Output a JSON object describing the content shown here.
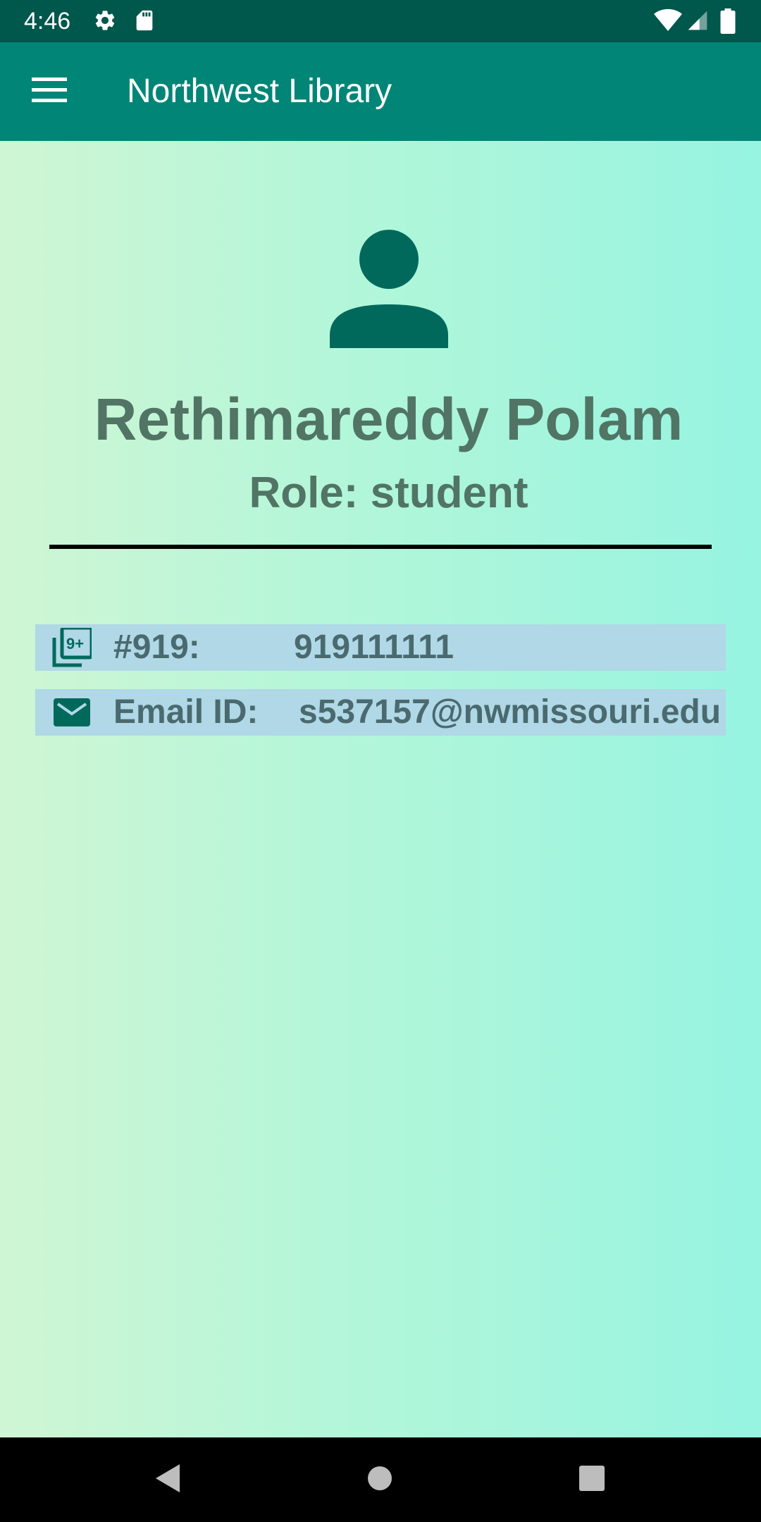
{
  "status_bar": {
    "time": "4:46",
    "icons": [
      "gear-icon",
      "sd-card-icon",
      "wifi-icon",
      "cell-signal-icon",
      "battery-icon"
    ]
  },
  "app_bar": {
    "title": "Northwest Library",
    "menu_icon": "hamburger-menu-icon"
  },
  "profile": {
    "avatar_icon": "person-icon",
    "name": "Rethimareddy Polam",
    "role": "Role: student"
  },
  "info_rows": [
    {
      "icon": "filter-9-plus-icon",
      "label": "#919:",
      "value": "919111111"
    },
    {
      "icon": "email-icon",
      "label": "Email ID:",
      "value": "s537157@nwmissouri.edu"
    }
  ],
  "colors": {
    "status_bar": "#00574b",
    "app_bar": "#008577",
    "icon_green": "#00695c",
    "text_green": "#517465",
    "row_background": "#b0d8e6"
  },
  "nav_bar": {
    "buttons": [
      "back-icon",
      "home-icon",
      "recents-icon"
    ]
  }
}
